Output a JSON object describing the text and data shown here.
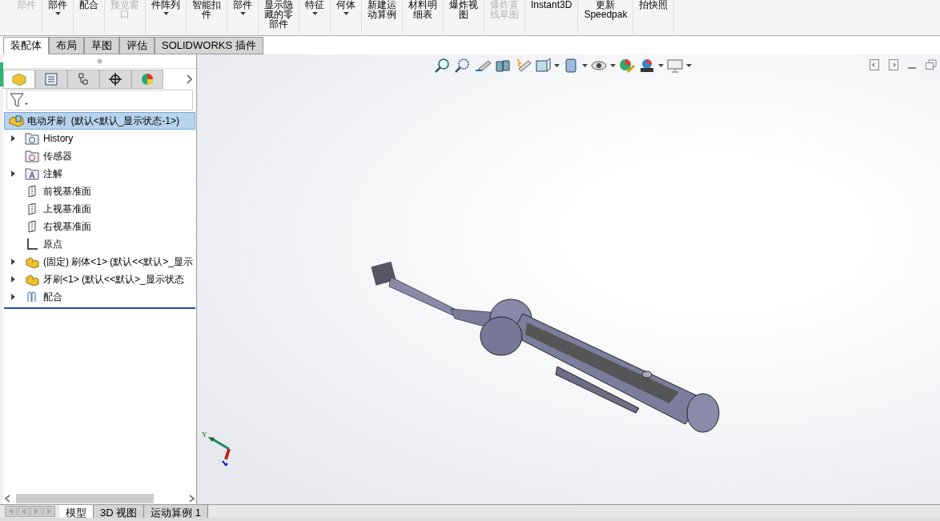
{
  "ribbon": [
    {
      "lines": [
        "部件"
      ],
      "disabled": true,
      "dropdown": false
    },
    {
      "lines": [
        "部件"
      ],
      "disabled": false,
      "dropdown": true
    },
    {
      "lines": [
        "配合"
      ],
      "disabled": false,
      "dropdown": false
    },
    {
      "lines": [
        "预览窗",
        "口"
      ],
      "disabled": true,
      "dropdown": false
    },
    {
      "lines": [
        "件阵列"
      ],
      "disabled": false,
      "dropdown": true
    },
    {
      "lines": [
        "智能扣",
        "件"
      ],
      "disabled": false,
      "dropdown": false
    },
    {
      "lines": [
        "部件"
      ],
      "disabled": false,
      "dropdown": true
    },
    {
      "lines": [
        "显示隐",
        "藏的零",
        "部件"
      ],
      "disabled": false,
      "dropdown": false
    },
    {
      "lines": [
        "特征"
      ],
      "disabled": false,
      "dropdown": true
    },
    {
      "lines": [
        "何体"
      ],
      "disabled": false,
      "dropdown": true
    },
    {
      "lines": [
        "新建运",
        "动算例"
      ],
      "disabled": false,
      "dropdown": false
    },
    {
      "lines": [
        "材料明",
        "细表"
      ],
      "disabled": false,
      "dropdown": false
    },
    {
      "lines": [
        "爆炸视",
        "图"
      ],
      "disabled": false,
      "dropdown": false
    },
    {
      "lines": [
        "爆炸直",
        "线草图"
      ],
      "disabled": true,
      "dropdown": false
    },
    {
      "lines": [
        "Instant3D"
      ],
      "disabled": false,
      "dropdown": false
    },
    {
      "lines": [
        "更新",
        "Speedpak"
      ],
      "disabled": false,
      "dropdown": false
    },
    {
      "lines": [
        "拍快照"
      ],
      "disabled": false,
      "dropdown": false
    }
  ],
  "tabs": [
    {
      "label": "装配体",
      "selected": true
    },
    {
      "label": "布局",
      "selected": false
    },
    {
      "label": "草图",
      "selected": false
    },
    {
      "label": "评估",
      "selected": false
    },
    {
      "label": "SOLIDWORKS 插件",
      "selected": false
    }
  ],
  "tree": {
    "label": "电动牙刷  (默认<默认_显示状态-1>)",
    "selected": true,
    "children": [
      {
        "kind": "history",
        "label": "History",
        "expanded": false
      },
      {
        "kind": "sensor",
        "label": "传感器"
      },
      {
        "kind": "annotation",
        "label": "注解",
        "expanded": false
      },
      {
        "kind": "plane",
        "label": "前视基准面"
      },
      {
        "kind": "plane",
        "label": "上视基准面"
      },
      {
        "kind": "plane",
        "label": "右视基准面"
      },
      {
        "kind": "origin",
        "label": "原点"
      },
      {
        "kind": "part",
        "label": "(固定) 刷体<1> (默认<<默认>_显示",
        "expanded": false
      },
      {
        "kind": "part",
        "label": "牙刷<1> (默认<<默认>_显示状态",
        "expanded": false
      },
      {
        "kind": "mates",
        "label": "配合",
        "expanded": false
      }
    ]
  },
  "triad": {
    "axis_label": "Y"
  },
  "bottom_tabs": [
    {
      "label": "模型",
      "selected": true
    },
    {
      "label": "3D 视图",
      "selected": false
    },
    {
      "label": "运动算例 1",
      "selected": false
    }
  ]
}
